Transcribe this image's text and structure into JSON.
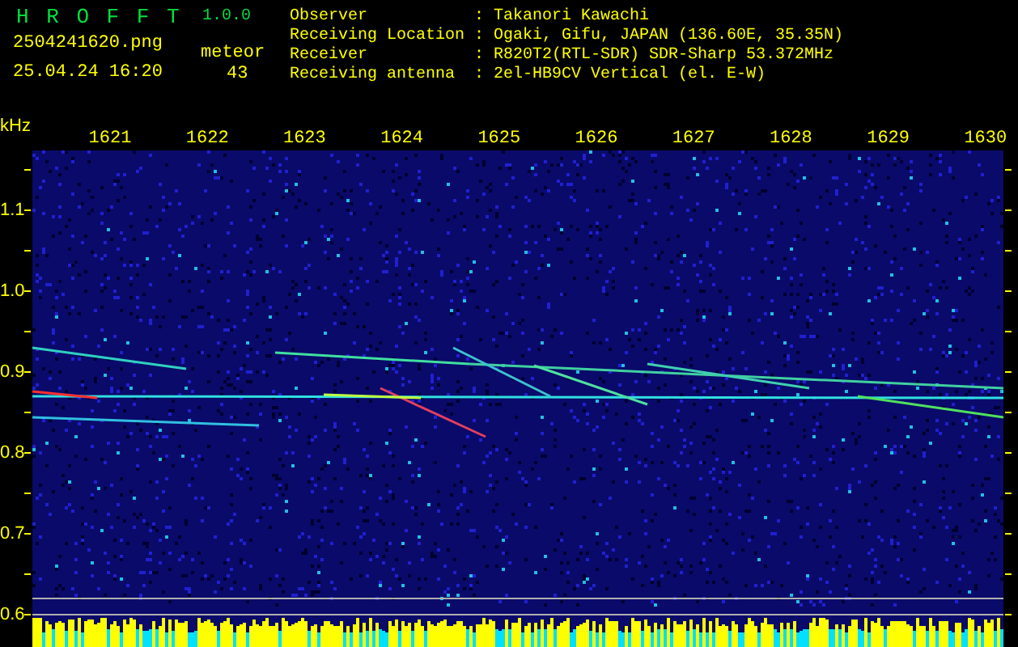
{
  "app": {
    "name": "H R O F F T",
    "version": "1.0.0"
  },
  "file": "2504241620.png",
  "datetime": "25.04.24 16:20",
  "counter": {
    "label": "meteor",
    "value": "43"
  },
  "info": [
    {
      "label": "Observer",
      "separator": ":",
      "value": "Takanori Kawachi"
    },
    {
      "label": "Receiving Location",
      "separator": ":",
      "value": "Ogaki, Gifu, JAPAN (136.60E, 35.35N)"
    },
    {
      "label": "Receiver",
      "separator": ":",
      "value": "R820T2(RTL-SDR) SDR-Sharp 53.372MHz"
    },
    {
      "label": "Receiving antenna",
      "separator": ":",
      "value": "2el-HB9CV Vertical (el. E-W)"
    }
  ],
  "plot": {
    "unit": "kHz",
    "x_labels": [
      "1621",
      "1622",
      "1623",
      "1624",
      "1625",
      "1626",
      "1627",
      "1628",
      "1629",
      "1630"
    ],
    "y_labels": [
      "1.1",
      "1.0",
      "0.9",
      "0.8",
      "0.7",
      "0.6"
    ]
  }
}
